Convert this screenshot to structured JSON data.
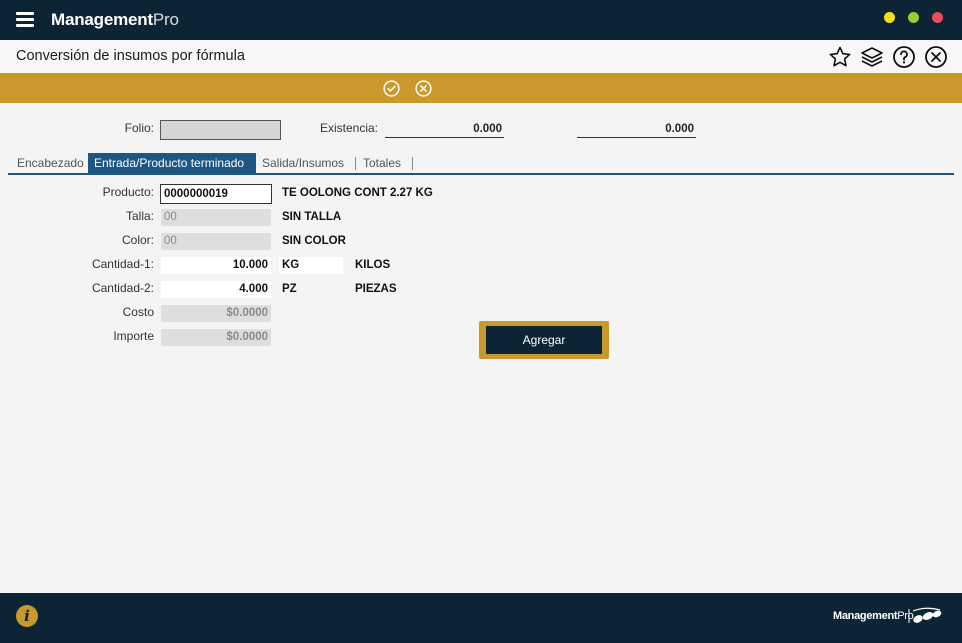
{
  "app": {
    "brand_bold": "Management",
    "brand_light": "Pro"
  },
  "window": {
    "controls": [
      "minimize",
      "maximize",
      "close"
    ]
  },
  "page": {
    "title": "Conversión de insumos por fórmula"
  },
  "header_icons": [
    "star-icon",
    "layers-icon",
    "help-icon",
    "close-icon"
  ],
  "actionbar": {
    "icons": [
      "check-icon",
      "cancel-icon"
    ]
  },
  "top": {
    "folio_label": "Folio:",
    "folio_value": "",
    "existencia_label": "Existencia:",
    "existencia_1": "0.000",
    "existencia_2": "0.000"
  },
  "tabs": [
    {
      "label": "Encabezado",
      "active": false
    },
    {
      "label": "Entrada/Producto terminado",
      "active": true
    },
    {
      "label": "Salida/Insumos",
      "active": false
    },
    {
      "label": "Totales",
      "active": false
    }
  ],
  "form": {
    "producto": {
      "label": "Producto:",
      "value": "0000000019",
      "desc": "TE OOLONG CONT 2.27 KG"
    },
    "talla": {
      "label": "Talla:",
      "value": "00",
      "desc": "SIN TALLA"
    },
    "color": {
      "label": "Color:",
      "value": "00",
      "desc": "SIN COLOR"
    },
    "cantidad1": {
      "label": "Cantidad-1:",
      "value": "10.000",
      "unit": "KG",
      "unit_desc": "KILOS"
    },
    "cantidad2": {
      "label": "Cantidad-2:",
      "value": "4.000",
      "unit": "PZ",
      "unit_desc": "PIEZAS"
    },
    "costo": {
      "label": "Costo",
      "value": "$0.0000"
    },
    "importe": {
      "label": "Importe",
      "value": "$0.0000"
    }
  },
  "add_button": {
    "label": "Agregar"
  },
  "footer": {
    "logo_bold": "Management",
    "logo_light": "Pro",
    "icons": [
      "info-icon"
    ]
  },
  "colors": {
    "navy": "#0d2434",
    "gold": "#c9992d",
    "tab_blue": "#1d5683"
  }
}
